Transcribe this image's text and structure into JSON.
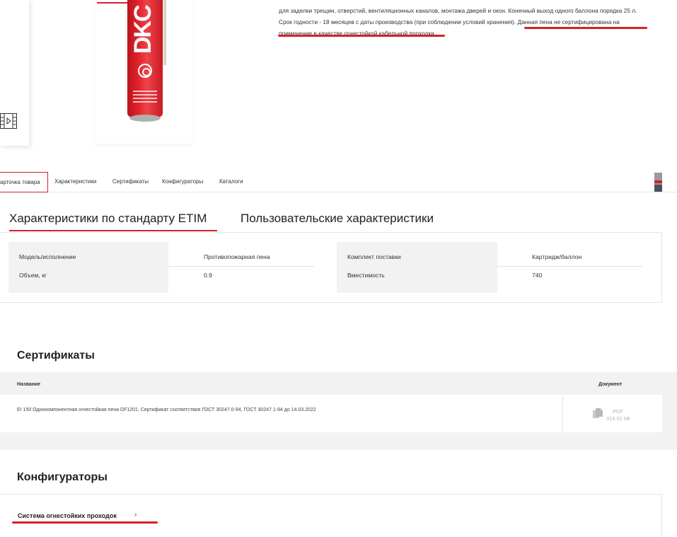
{
  "product": {
    "brand_text": "DKC",
    "description_line1": "для заделки трещин, отверстий, вентиляционных каналов, монтажа дверей и окон. Конечный выход одного баллона порядка 25 л.",
    "description_line2a": "Срок годности - 18 месяцев с даты производства (при соблюдении условий хранения).",
    "description_line2b": " Данная пена не сертифицирована на",
    "description_line3": "применение в качестве огнестойкой кабельной проходки."
  },
  "tabs": [
    {
      "label": "арточка товара",
      "active": true
    },
    {
      "label": "Характеристики"
    },
    {
      "label": "Сертификаты"
    },
    {
      "label": "Конфигураторы"
    },
    {
      "label": "Каталоги"
    }
  ],
  "characteristics": {
    "subtabs": [
      "Характеристики по стандарту ETIM",
      "Пользовательские характеристики"
    ],
    "rows_left": [
      {
        "name": "Модель/исполнение",
        "value": "Противопожарная пена"
      },
      {
        "name": "Объем, кг",
        "value": "0.9"
      }
    ],
    "rows_right": [
      {
        "name": "Комплект поставки",
        "value": "Картридж/баллон"
      },
      {
        "name": "Вместимость",
        "value": "740"
      }
    ]
  },
  "certificates": {
    "title": "Сертификаты",
    "col_name": "Название",
    "col_doc": "Документ",
    "item_name": "EI 150 Однокомпонентная огнестойкая пена DF1201, Сертификат соответствия ГОСТ 30247.0-94, ГОСТ 30247.1-94 до 14.03.2022",
    "file_type": "PDF",
    "file_size": "316.01 kB"
  },
  "configurators": {
    "title": "Конфигураторы",
    "link_label": "Система огнестойких проходок",
    "chevron": "›"
  },
  "colors": {
    "accent": "#d6202a",
    "panel_grey": "#f2f2f2"
  }
}
